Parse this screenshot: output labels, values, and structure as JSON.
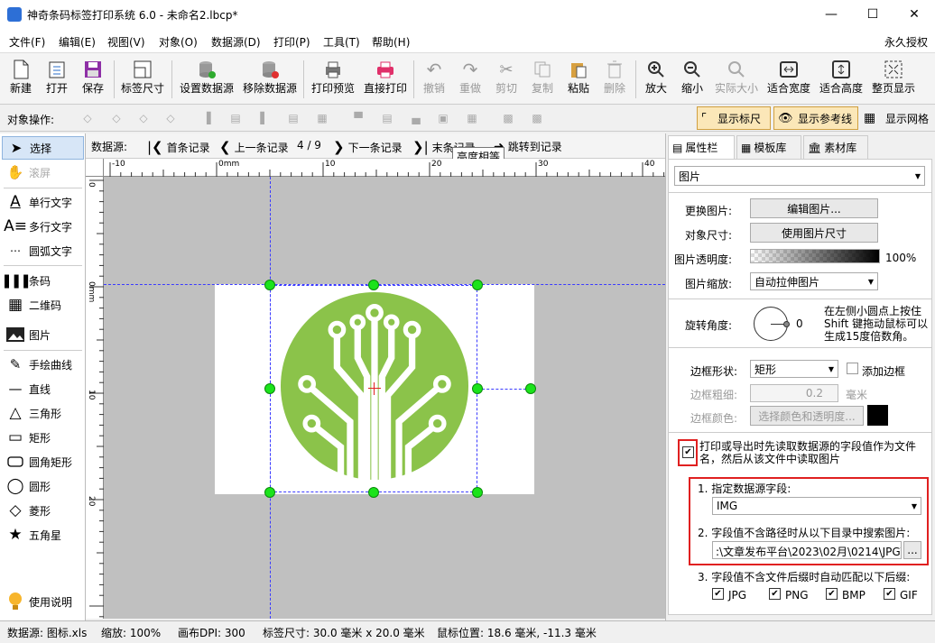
{
  "window": {
    "title": "神奇条码标签打印系统 6.0 - 未命名2.lbcp*"
  },
  "menu": {
    "items": [
      "文件(F)",
      "编辑(E)",
      "视图(V)",
      "对象(O)",
      "数据源(D)",
      "打印(P)",
      "工具(T)",
      "帮助(H)"
    ],
    "license": "永久授权"
  },
  "toolbar": {
    "new": "新建",
    "open": "打开",
    "save": "保存",
    "label_size": "标签尺寸",
    "set_datasource": "设置数据源",
    "remove_datasource": "移除数据源",
    "print_preview": "打印预览",
    "print_direct": "直接打印",
    "undo": "撤销",
    "redo": "重做",
    "cut": "剪切",
    "copy": "复制",
    "paste": "粘贴",
    "delete": "删除",
    "zoom_in": "放大",
    "zoom_out": "缩小",
    "actual_size": "实际大小",
    "fit_width": "适合宽度",
    "fit_height": "适合高度",
    "full_page": "整页显示"
  },
  "objbar": {
    "label": "对象操作:",
    "show_ruler": "显示标尺",
    "show_guides": "显示参考线",
    "show_grid": "显示网格"
  },
  "tools": {
    "select": "选择",
    "scroll": "滚屏",
    "single_text": "单行文字",
    "multi_text": "多行文字",
    "arc_text": "圆弧文字",
    "barcode": "条码",
    "qrcode": "二维码",
    "image": "图片",
    "freehand": "手绘曲线",
    "line": "直线",
    "triangle": "三角形",
    "rect": "矩形",
    "round_rect": "圆角矩形",
    "circle": "圆形",
    "diamond": "菱形",
    "star": "五角星",
    "help": "使用说明"
  },
  "nav": {
    "label": "数据源:",
    "first": "首条记录",
    "prev": "上一条记录",
    "position": "4 / 9",
    "next": "下一条记录",
    "last": "末条记录",
    "jump": "跳转到记录",
    "tooltip": "高度相等"
  },
  "ruler": {
    "h_ticks": [
      "-10",
      "0mm",
      "10",
      "20",
      "30",
      "40"
    ],
    "v_ticks": [
      "0",
      "0mm",
      "10",
      "20"
    ]
  },
  "panel": {
    "tabs": [
      "属性栏",
      "模板库",
      "素材库"
    ],
    "object_type": "图片",
    "change_image_label": "更换图片:",
    "edit_image_btn": "编辑图片...",
    "object_size_label": "对象尺寸:",
    "use_image_size_btn": "使用图片尺寸",
    "opacity_label": "图片透明度:",
    "opacity_value": "100%",
    "scale_label": "图片缩放:",
    "scale_value": "自动拉伸图片",
    "rotation_label": "旋转角度:",
    "rotation_value": "0",
    "rotation_hint": "在左侧小圆点上按住 Shift 键拖动鼠标可以生成15度倍数角。",
    "border_shape_label": "边框形状:",
    "border_shape_value": "矩形",
    "add_border": "添加边框",
    "border_width_label": "边框粗细:",
    "border_width_value": "0.2",
    "border_width_unit": "毫米",
    "border_color_label": "边框颜色:",
    "border_color_btn": "选择颜色和透明度...",
    "read_file_text": "打印或导出时先读取数据源的字段值作为文件名，然后从该文件中读取图片",
    "field_label": "1. 指定数据源字段:",
    "field_value": "IMG",
    "dir_label": "2. 字段值不含路径时从以下目录中搜索图片:",
    "dir_value": ":\\文章发布平台\\2023\\02月\\0214\\JPG\\",
    "browse": "...",
    "ext_label": "3. 字段值不含文件后缀时自动匹配以下后缀:",
    "ext": [
      "JPG",
      "PNG",
      "BMP",
      "GIF"
    ]
  },
  "status": {
    "datasource": "数据源: 图标.xls",
    "zoom": "缩放: 100%",
    "dpi": "画布DPI: 300",
    "label_size": "标签尺寸: 30.0 毫米 x 20.0 毫米",
    "mouse": "鼠标位置: 18.6 毫米, -11.3 毫米"
  },
  "colors": {
    "logo_green": "#8bc34a",
    "handle": "#1be31b",
    "highlight": "#e02020",
    "guide": "#3a3aff"
  }
}
